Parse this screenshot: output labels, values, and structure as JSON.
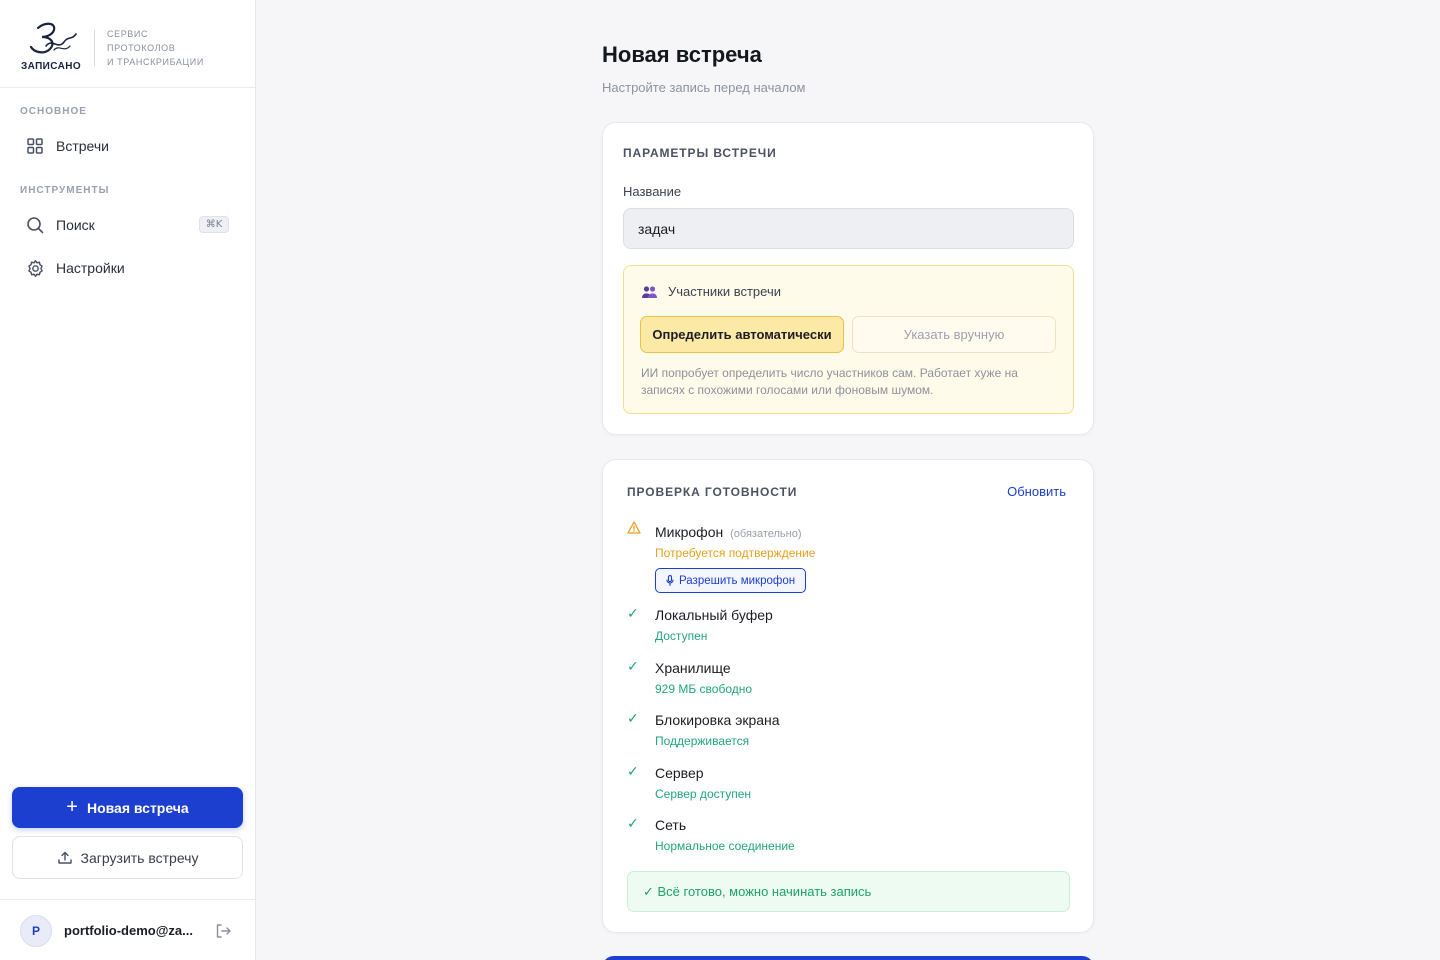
{
  "brand": {
    "name": "ЗАПИСАНО",
    "tagline": [
      "СЕРВИС",
      "ПРОТОКОЛОВ",
      "И ТРАНСКРИБАЦИИ"
    ]
  },
  "sidebar": {
    "section_main": "ОСНОВНОЕ",
    "section_tools": "ИНСТРУМЕНТЫ",
    "items": [
      {
        "label": "Встречи",
        "icon": "grid-icon"
      },
      {
        "label": "Поиск",
        "icon": "search-icon",
        "shortcut": "⌘K"
      },
      {
        "label": "Настройки",
        "icon": "gear-icon"
      }
    ],
    "new_meeting_label": "Новая встреча",
    "upload_label": "Загрузить встречу",
    "user": {
      "initial": "P",
      "email": "portfolio-demo@za..."
    }
  },
  "main": {
    "title": "Новая встреча",
    "subtitle": "Настройте запись перед началом",
    "params": {
      "title": "ПАРАМЕТРЫ ВСТРЕЧИ",
      "name_label": "Название",
      "name_value": "задач",
      "participants": {
        "heading": "Участники встречи",
        "auto_label": "Определить автоматически",
        "manual_label": "Указать вручную",
        "selected": "auto",
        "note": "ИИ попробует определить число участников сам. Работает хуже на записях с похожими голосами или фоновым шумом."
      }
    },
    "readiness": {
      "title": "ПРОВЕРКА ГОТОВНОСТИ",
      "refresh_label": "Обновить",
      "checks": [
        {
          "title": "Микрофон",
          "optional": "(обязательно)",
          "status": "Потребуется подтверждение",
          "state": "warn",
          "action": "Разрешить микрофон"
        },
        {
          "title": "Локальный буфер",
          "status": "Доступен",
          "state": "ok"
        },
        {
          "title": "Хранилище",
          "status": "929 МБ свободно",
          "state": "ok"
        },
        {
          "title": "Блокировка экрана",
          "status": "Поддерживается",
          "state": "ok"
        },
        {
          "title": "Сервер",
          "status": "Сервер доступен",
          "state": "ok"
        },
        {
          "title": "Сеть",
          "status": "Нормальное соединение",
          "state": "ok"
        }
      ],
      "ready_message": "✓ Всё готово, можно начинать запись"
    }
  },
  "colors": {
    "accent": "#1c3fcf",
    "success": "#21a57c",
    "warning": "#e4a11b",
    "participants_bg": "#fffbea"
  }
}
